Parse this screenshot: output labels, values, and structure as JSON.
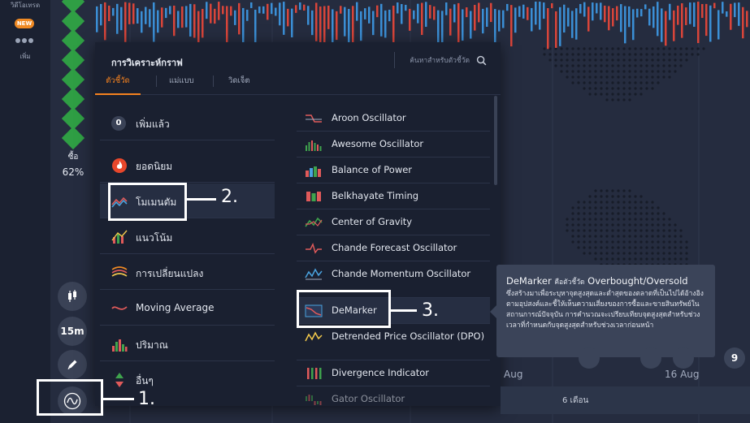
{
  "sidebar": {
    "top_label": "วิดีโอเทรด",
    "new_badge": "NEW",
    "more_label": "เพิ่ม"
  },
  "sentiment": {
    "label": "ซื้อ",
    "percent": "62%"
  },
  "tools": {
    "timeframe": "15m"
  },
  "dialog": {
    "title": "การวิเคราะห์กราฟ",
    "search_placeholder": "ค้นหาสำหรับตัวชี้วัด",
    "tabs": [
      "ตัวชี้วัด",
      "แม่แบบ",
      "วิดเจ็ต"
    ],
    "active_tab": 0,
    "categories": [
      {
        "label": "เพิ่มแล้ว",
        "badge": "0",
        "icon": "count-badge"
      },
      {
        "label": "ยอดนิยม",
        "icon": "fire-icon"
      },
      {
        "label": "โมเมนตัม",
        "icon": "momentum-icon"
      },
      {
        "label": "แนวโน้ม",
        "icon": "trend-icon"
      },
      {
        "label": "การเปลี่ยนแปลง",
        "icon": "volatility-icon"
      },
      {
        "label": "Moving Average",
        "icon": "moving-average-icon"
      },
      {
        "label": "ปริมาณ",
        "icon": "volume-icon"
      },
      {
        "label": "อื่นๆ",
        "icon": "other-icon"
      }
    ],
    "active_category": 2,
    "indicators": [
      {
        "label": "Aroon Oscillator",
        "icon": "aroon-icon"
      },
      {
        "label": "Awesome Oscillator",
        "icon": "awesome-icon"
      },
      {
        "label": "Balance of Power",
        "icon": "bop-icon"
      },
      {
        "label": "Belkhayate Timing",
        "icon": "belkhayate-icon"
      },
      {
        "label": "Center of Gravity",
        "icon": "cog-icon"
      },
      {
        "label": "Chande Forecast Oscillator",
        "icon": "cfo-icon"
      },
      {
        "label": "Chande Momentum Oscillator",
        "icon": "cmo-icon"
      },
      {
        "label": "DeMarker",
        "icon": "demarker-icon"
      },
      {
        "label": "Detrended Price Oscillator (DPO)",
        "icon": "dpo-icon"
      },
      {
        "label": "Divergence Indicator",
        "icon": "divergence-icon"
      },
      {
        "label": "Gator Oscillator",
        "icon": "gator-icon"
      }
    ],
    "active_indicator": 7
  },
  "tooltip": {
    "name": "DeMarker",
    "desc_prefix": "คือตัวชี้วัด",
    "type": "Overbought/Oversold",
    "body": "ซึ่งสร้างมาเพื่อระบุหาจุดสูงสุดและต่ำสุดของตลาดที่เป็นไปได้อ้างอิงตามอุปสงค์และชี้ให้เห็นความเสี่ยงของการซื้อและขายสินทรัพย์ในสถานการณ์ปัจจุบัน การคำนวณจะเปรียบเทียบจุดสูงสุดสำหรับช่วงเวลาที่กำหนดกับจุดสูงสุดสำหรับช่วงเวลาก่อนหน้า"
  },
  "timeline": {
    "date_left": "Aug",
    "date_right": "16 Aug",
    "range_label": "6 เดือน",
    "circle_right": "9"
  },
  "annotations": [
    "1.",
    "2.",
    "3."
  ],
  "colors": {
    "accent": "#f5821f",
    "buy_green": "#2f9e44",
    "candle_red": "#d9453a",
    "candle_blue": "#3b8fd6"
  }
}
